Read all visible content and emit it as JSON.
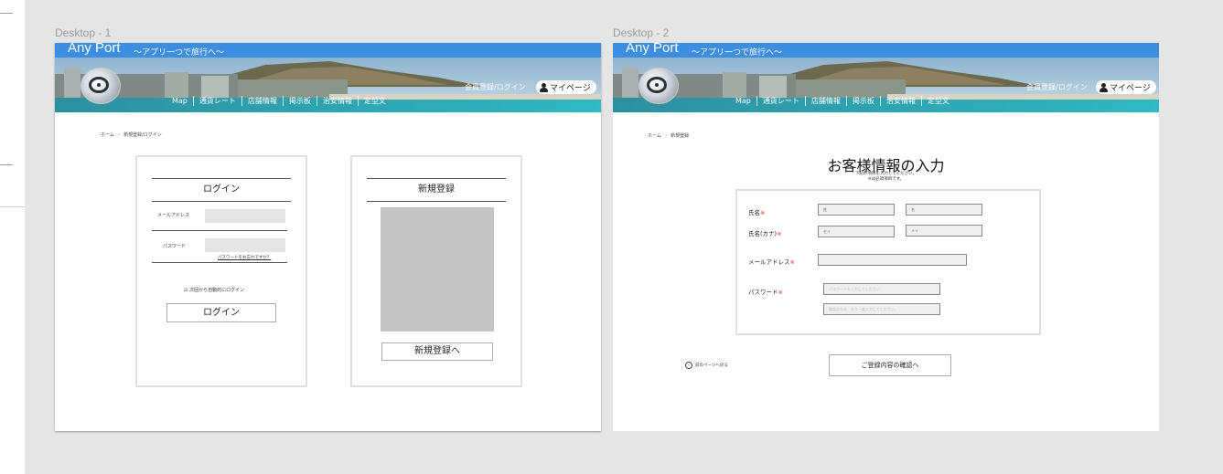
{
  "artboards": [
    {
      "label": "Desktop - 1",
      "header": {
        "brand": "Any Port",
        "tagline": "～アプリ一つで旅行へ～",
        "nav": [
          "Map",
          "通貨レート",
          "店舗情報",
          "掲示板",
          "治安情報",
          "定型文"
        ],
        "auth_link": "会員登録/ログイン",
        "mypage": "マイページ"
      },
      "breadcrumb": [
        "ホーム",
        "新規登録/ログイン"
      ],
      "login": {
        "title": "ログイン",
        "email_label": "メールアドレス",
        "password_label": "パスワード",
        "forgot": "パスワードをお忘れですか？",
        "auto_login": "☑ 次回から自動的にログイン",
        "button": "ログイン"
      },
      "register": {
        "title": "新規登録",
        "button": "新規登録へ"
      }
    },
    {
      "label": "Desktop - 2",
      "header": {
        "brand": "Any Port",
        "tagline": "～アプリ一つで旅行へ～",
        "nav": [
          "Map",
          "通貨レート",
          "店舗情報",
          "掲示板",
          "治安情報",
          "定型文"
        ],
        "auth_link": "会員登録/ログイン",
        "mypage": "マイページ"
      },
      "breadcrumb": [
        "ホーム",
        "新規登録"
      ],
      "title": "お客様情報の入力",
      "subtitle": [
        "下記の項目を入力してください。",
        "※は必須項目です。"
      ],
      "required_mark": "※",
      "form": {
        "name_label": "氏名",
        "surname_placeholder": "姓",
        "given_placeholder": "名",
        "kana_label": "氏名(カナ)",
        "surname_kana_placeholder": "セイ",
        "given_kana_placeholder": "メイ",
        "email_label": "メールアドレス",
        "password_label": "パスワード",
        "password_placeholder": "パスワードを入力してください",
        "password_confirm_placeholder": "確認のため、もう一度入力してください。"
      },
      "back_link": "前のページへ戻る",
      "confirm_button": "ご登録内容の確認へ"
    }
  ]
}
